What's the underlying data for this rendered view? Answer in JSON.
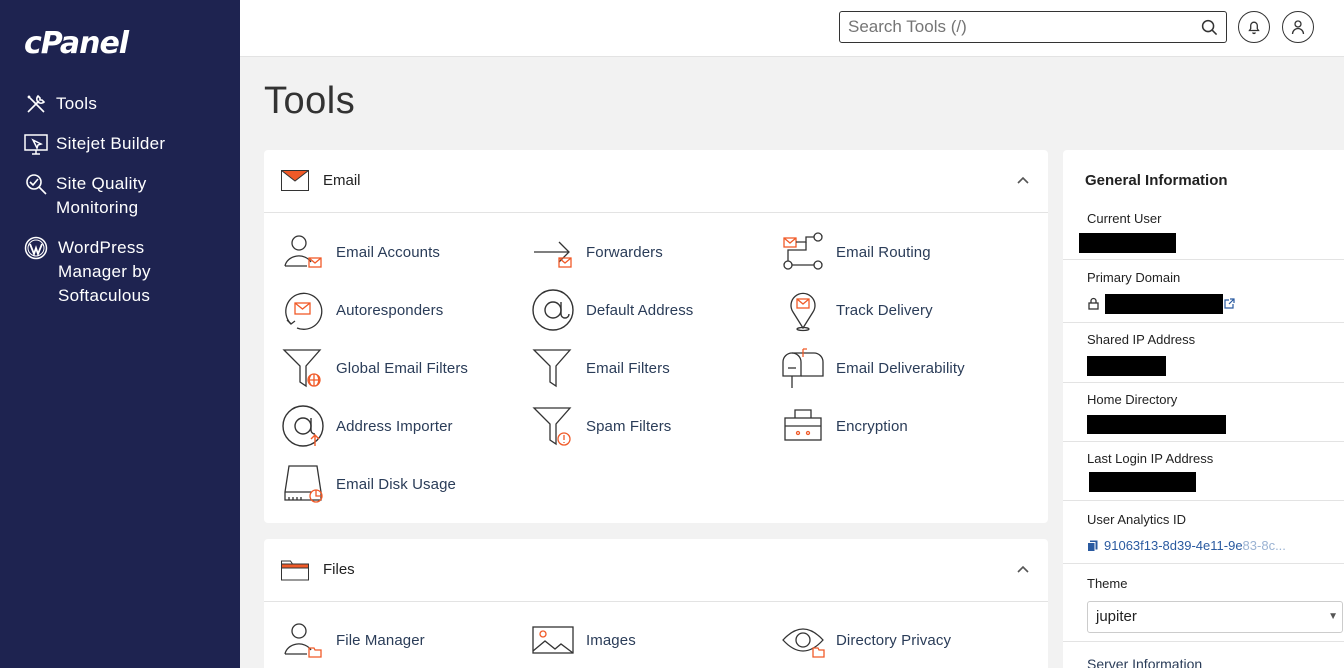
{
  "brand": "cPanel",
  "sidebar": {
    "items": [
      {
        "label": "Tools",
        "icon": "tools-icon"
      },
      {
        "label": "Sitejet Builder",
        "icon": "sitejet-icon"
      },
      {
        "label": "Site Quality Monitoring",
        "icon": "site-quality-icon"
      },
      {
        "label": "WordPress Manager by Softaculous",
        "icon": "wordpress-icon"
      }
    ]
  },
  "header": {
    "search_placeholder": "Search Tools (/)"
  },
  "page_title": "Tools",
  "sections": {
    "email": {
      "title": "Email",
      "tools": [
        "Email Accounts",
        "Forwarders",
        "Email Routing",
        "Autoresponders",
        "Default Address",
        "Track Delivery",
        "Global Email Filters",
        "Email Filters",
        "Email Deliverability",
        "Address Importer",
        "Spam Filters",
        "Encryption",
        "Email Disk Usage"
      ]
    },
    "files": {
      "title": "Files",
      "tools": [
        "File Manager",
        "Images",
        "Directory Privacy"
      ]
    }
  },
  "general_info": {
    "title": "General Information",
    "current_user_label": "Current User",
    "primary_domain_label": "Primary Domain",
    "shared_ip_label": "Shared IP Address",
    "home_directory_label": "Home Directory",
    "last_login_label": "Last Login IP Address",
    "user_analytics_label": "User Analytics ID",
    "user_analytics_value": "91063f13-8d39-4e11-9e",
    "user_analytics_faded": "83-8c...",
    "theme_label": "Theme",
    "theme_value": "jupiter",
    "server_info_label": "Server Information"
  },
  "colors": {
    "sidebar_bg": "#1e2350",
    "accent_orange": "#f05a28",
    "link": "#2a3c58"
  }
}
